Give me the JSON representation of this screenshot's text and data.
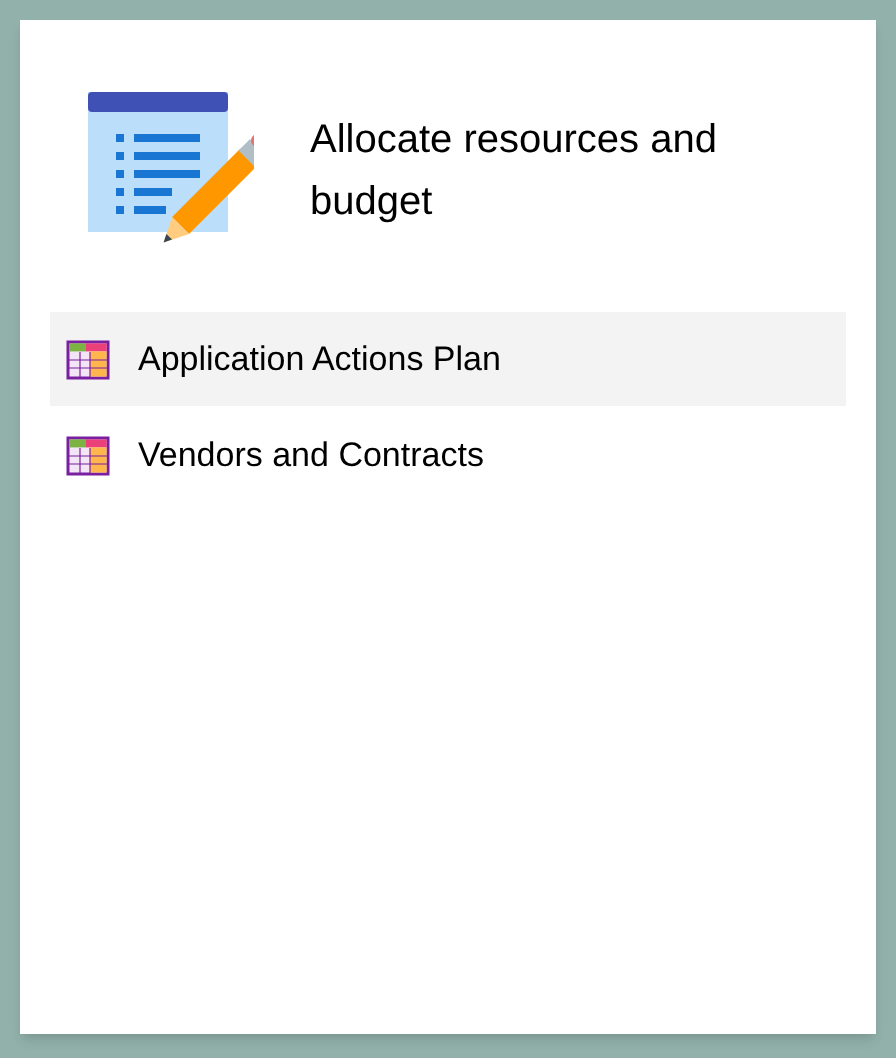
{
  "header": {
    "title": "Allocate resources and budget"
  },
  "items": [
    {
      "label": "Application Actions Plan",
      "selected": true
    },
    {
      "label": "Vendors and Contracts",
      "selected": false
    }
  ]
}
